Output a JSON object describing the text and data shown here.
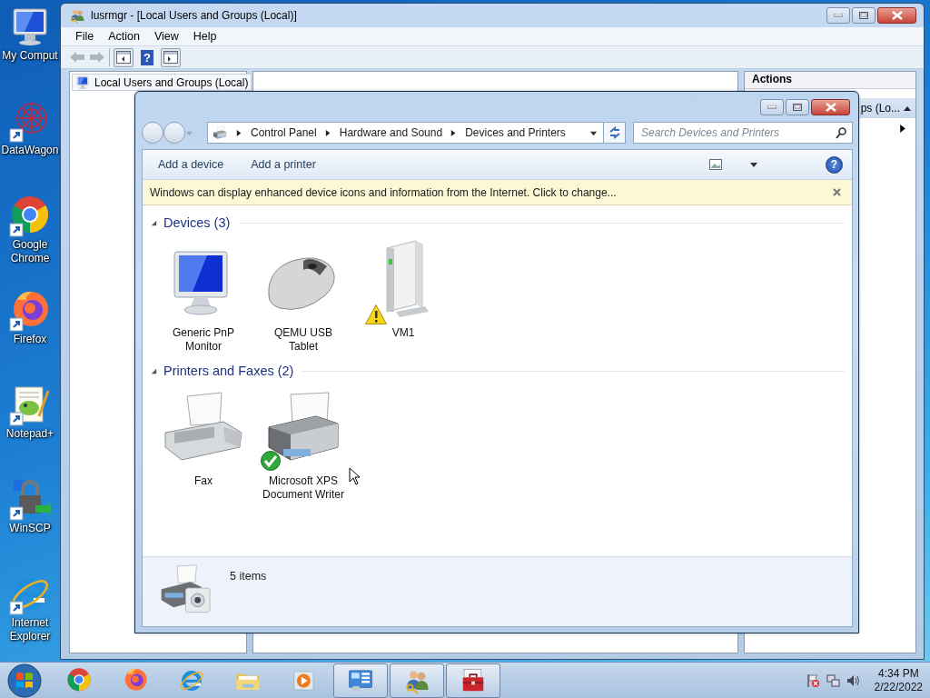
{
  "desktop_icons": [
    {
      "label": "My Comput",
      "kind": "computer",
      "shortcut": false
    },
    {
      "label": "DataWagon",
      "kind": "datawagon",
      "shortcut": true
    },
    {
      "label": "Google\nChrome",
      "kind": "chrome",
      "shortcut": true
    },
    {
      "label": "Firefox",
      "kind": "firefox",
      "shortcut": true
    },
    {
      "label": "Notepad+",
      "kind": "notepad",
      "shortcut": true
    },
    {
      "label": "WinSCP",
      "kind": "winscp",
      "shortcut": true
    },
    {
      "label": "Internet\nExplorer",
      "kind": "ie",
      "shortcut": true
    }
  ],
  "mmc_window": {
    "title": "lusrmgr - [Local Users and Groups (Local)]",
    "menu": [
      "File",
      "Action",
      "View",
      "Help"
    ],
    "toolbar": [
      {
        "kind": "back",
        "disabled": true
      },
      {
        "kind": "forward",
        "disabled": true
      },
      {
        "kind": "tree",
        "disabled": false
      },
      {
        "kind": "help",
        "label": "?",
        "disabled": false
      },
      {
        "kind": "pane",
        "disabled": false
      }
    ],
    "tree_root": "Local Users and Groups (Local)",
    "actions": {
      "header": "Actions",
      "section": "ps (Lo...",
      "expanded": true
    }
  },
  "front_window": {
    "breadcrumb": [
      "Control Panel",
      "Hardware and Sound",
      "Devices and Printers"
    ],
    "search": {
      "placeholder": "Search Devices and Printers"
    },
    "commands": [
      "Add a device",
      "Add a printer"
    ],
    "help_label": "?",
    "info_bar": "Windows can display enhanced device icons and information from the Internet. Click to change...",
    "groups": [
      {
        "title": "Devices (3)",
        "expanded": true,
        "items": [
          {
            "label": "Generic PnP\nMonitor",
            "kind": "monitor",
            "warning": false,
            "default": false
          },
          {
            "label": "QEMU USB\nTablet",
            "kind": "mouse",
            "warning": false,
            "default": false
          },
          {
            "label": "VM1",
            "kind": "tower",
            "warning": true,
            "default": false
          }
        ]
      },
      {
        "title": "Printers and Faxes (2)",
        "expanded": true,
        "items": [
          {
            "label": "Fax",
            "kind": "fax",
            "warning": false,
            "default": false
          },
          {
            "label": "Microsoft XPS\nDocument Writer",
            "kind": "printer",
            "warning": false,
            "default": true
          }
        ]
      }
    ],
    "status": "5 items"
  },
  "taskbar": {
    "items": [
      {
        "kind": "chrome",
        "open": false
      },
      {
        "kind": "firefox",
        "open": false
      },
      {
        "kind": "ie",
        "open": false
      },
      {
        "kind": "folder",
        "open": false
      },
      {
        "kind": "media",
        "open": false
      },
      {
        "kind": "control-panel",
        "open": true
      },
      {
        "kind": "users",
        "open": true
      },
      {
        "kind": "toolbox",
        "open": true
      }
    ],
    "time": "4:34 PM",
    "date": "2/22/2022"
  }
}
